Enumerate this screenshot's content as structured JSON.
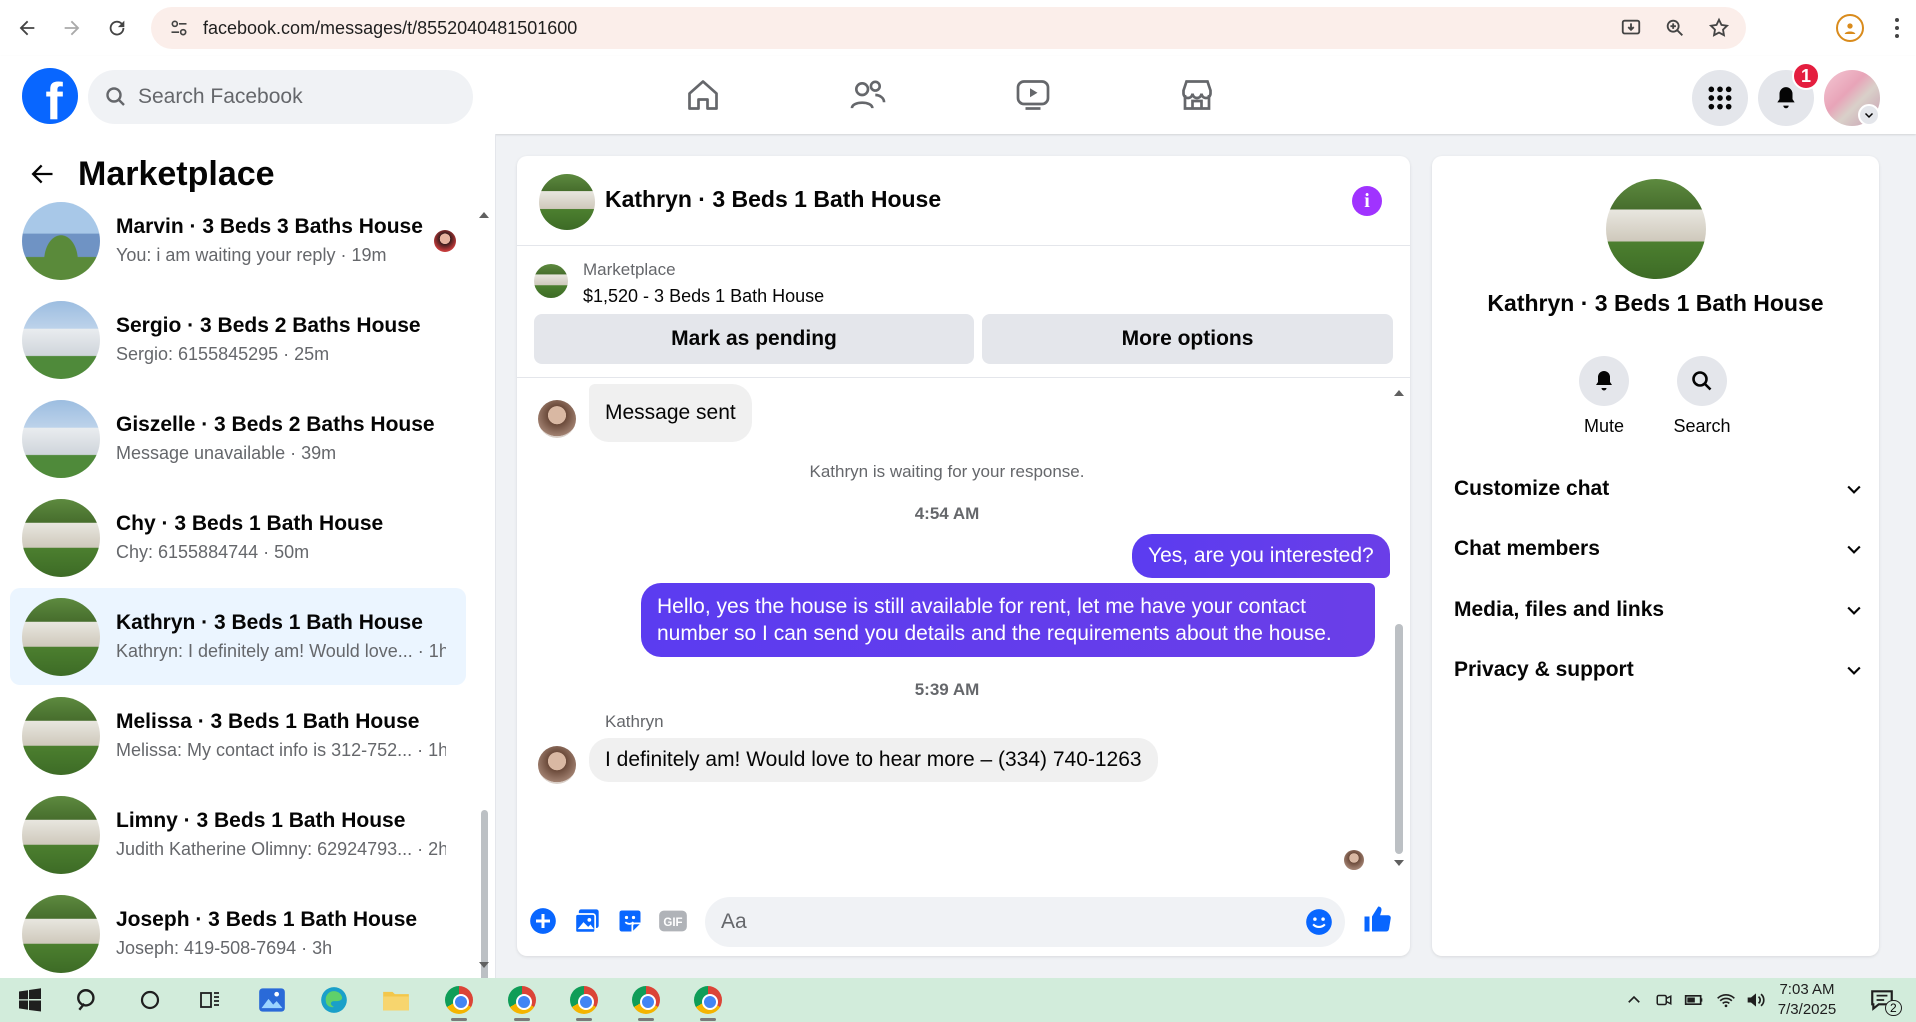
{
  "browser": {
    "url": "facebook.com/messages/t/8552040481501600"
  },
  "header": {
    "search_placeholder": "Search Facebook",
    "notification_count": "1"
  },
  "sidebar": {
    "title": "Marketplace",
    "conversations": [
      {
        "name": "Marvin · 3 Beds 3 Baths House",
        "preview": "You: i am waiting your reply · 19m",
        "thumb": "blue"
      },
      {
        "name": "Sergio · 3 Beds 2 Baths House",
        "preview": "Sergio: 6155845295 · 25m",
        "thumb": "white"
      },
      {
        "name": "Giszelle · 3 Beds 2 Baths House",
        "preview": "Message unavailable · 39m",
        "thumb": "white"
      },
      {
        "name": "Chy · 3 Beds 1 Bath House",
        "preview": "Chy: 6155884744 · 50m",
        "thumb": "cottage"
      },
      {
        "name": "Kathryn · 3 Beds 1 Bath House",
        "preview": "Kathryn: I definitely am! Would love... · 1h",
        "thumb": "cottage",
        "active": true
      },
      {
        "name": "Melissa · 3 Beds 1 Bath House",
        "preview": "Melissa: My contact info is 312-752... · 1h",
        "thumb": "cottage"
      },
      {
        "name": "Limny · 3 Beds 1 Bath House",
        "preview": "Judith Katherine Olimny: 62924793... · 2h",
        "thumb": "cottage"
      },
      {
        "name": "Joseph · 3 Beds 1 Bath House",
        "preview": "Joseph: 419-508-7694 · 3h",
        "thumb": "cottage"
      }
    ]
  },
  "chat": {
    "title": "Kathryn · 3 Beds 1 Bath House",
    "listing_label": "Marketplace",
    "listing_price": "$1,520 - 3 Beds 1 Bath House",
    "mark_pending_label": "Mark as pending",
    "more_options_label": "More options",
    "msg_sent": "Message sent",
    "waiting_text": "Kathryn is waiting for your response.",
    "time1": "4:54 AM",
    "out1": "Yes, are you interested?",
    "out2": "Hello, yes the house is still available for rent, let me have your contact number so I can send you details and the requirements about the house.",
    "time2": "5:39 AM",
    "sender": "Kathryn",
    "in1": "I definitely am! Would love to hear more – (334) 740-1263",
    "composer_placeholder": "Aa",
    "accent_color": "#5b3cf0"
  },
  "details": {
    "title": "Kathryn · 3 Beds 1 Bath House",
    "mute_label": "Mute",
    "search_label": "Search",
    "sections": [
      "Customize chat",
      "Chat members",
      "Media, files and links",
      "Privacy & support"
    ]
  },
  "taskbar": {
    "time": "7:03 AM",
    "date": "7/3/2025",
    "notification_count": "2"
  }
}
